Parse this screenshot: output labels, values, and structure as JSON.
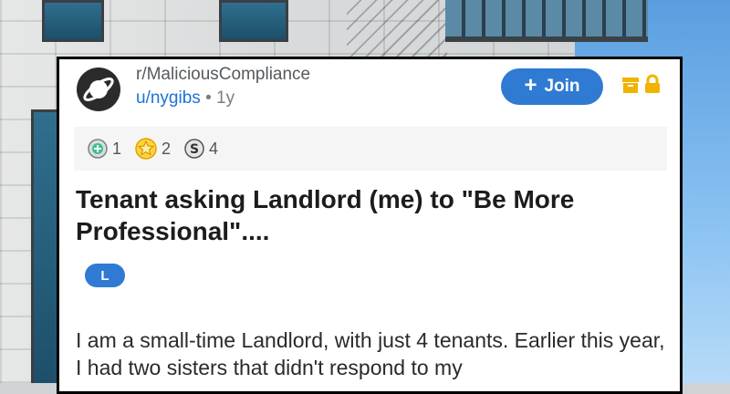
{
  "post": {
    "subreddit": "r/MaliciousCompliance",
    "author": "u/nygibs",
    "separator": "•",
    "age": "1y",
    "join_label": "Join",
    "awards": [
      {
        "icon": "helpful-award-icon",
        "count": "1"
      },
      {
        "icon": "wholesome-award-icon",
        "count": "2"
      },
      {
        "icon": "silver-award-icon",
        "count": "4"
      }
    ],
    "title": "Tenant asking Landlord (me) to \"Be More Professional\"....",
    "flair": "L",
    "body": "I am a small-time Landlord, with just 4 tenants. Earlier this year, I had two sisters that didn't respond to my"
  },
  "colors": {
    "accent": "#2f7ad3",
    "archive": "#f0b400"
  }
}
